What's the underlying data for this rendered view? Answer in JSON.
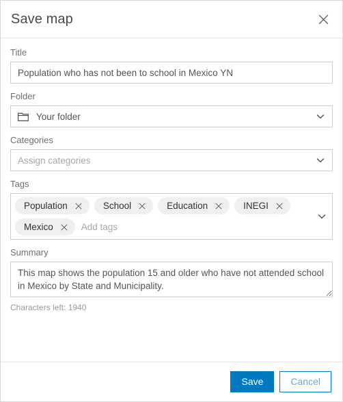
{
  "dialog": {
    "title": "Save map",
    "close_icon": "close-icon"
  },
  "fields": {
    "title": {
      "label": "Title",
      "value": "Population who has not been to school in Mexico YN",
      "placeholder": ""
    },
    "folder": {
      "label": "Folder",
      "value": "Your folder",
      "icon": "folder-icon",
      "chevron": "chevron-down-icon"
    },
    "categories": {
      "label": "Categories",
      "placeholder": "Assign categories",
      "value": "",
      "chevron": "chevron-down-icon"
    },
    "tags": {
      "label": "Tags",
      "chips": [
        {
          "label": "Population",
          "remove_icon": "close-icon"
        },
        {
          "label": "School",
          "remove_icon": "close-icon"
        },
        {
          "label": "Education",
          "remove_icon": "close-icon"
        },
        {
          "label": "INEGI",
          "remove_icon": "close-icon"
        },
        {
          "label": "Mexico",
          "remove_icon": "close-icon"
        }
      ],
      "input_placeholder": "Add tags",
      "input_value": "",
      "chevron": "chevron-down-icon"
    },
    "summary": {
      "label": "Summary",
      "value": "This map shows the population 15 and older who have not attended school in Mexico by State and Municipality.",
      "placeholder": "",
      "characters_left": "Characters left: 1940"
    }
  },
  "footer": {
    "save_label": "Save",
    "cancel_label": "Cancel"
  },
  "colors": {
    "accent": "#0079c1",
    "border": "#cfcfcf",
    "label_text": "#6e6e6e",
    "chip_bg": "#efefef",
    "placeholder": "#a8a8a8"
  }
}
